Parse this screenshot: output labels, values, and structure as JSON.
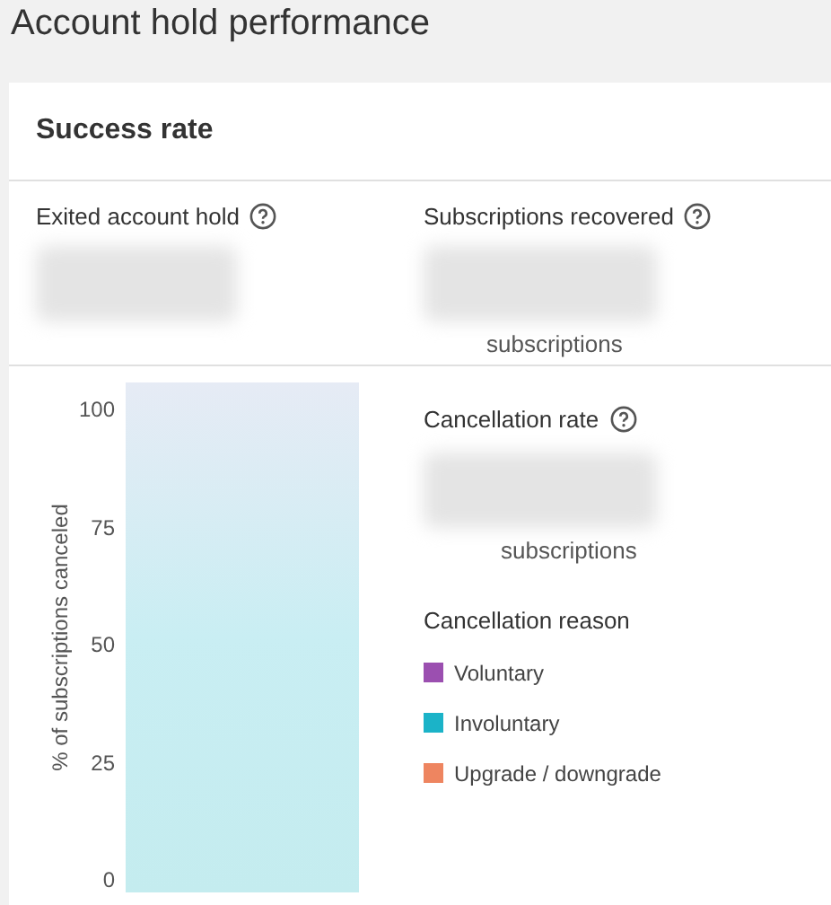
{
  "page_title": "Account hold performance",
  "card": {
    "title": "Success rate",
    "metrics": [
      {
        "label": "Exited account hold"
      },
      {
        "label": "Subscriptions recovered",
        "unit": "subscriptions"
      }
    ],
    "chart": {
      "y_axis_label": "% of subscriptions canceled",
      "y_ticks": [
        "100",
        "75",
        "50",
        "25",
        "0"
      ]
    },
    "cancellation": {
      "label": "Cancellation rate",
      "unit": "subscriptions"
    },
    "reason": {
      "title": "Cancellation reason",
      "legend": [
        {
          "label": "Voluntary",
          "color": "#9b4fb0"
        },
        {
          "label": "Involuntary",
          "color": "#1bb3c8"
        },
        {
          "label": "Upgrade / downgrade",
          "color": "#ee8560"
        }
      ]
    }
  }
}
